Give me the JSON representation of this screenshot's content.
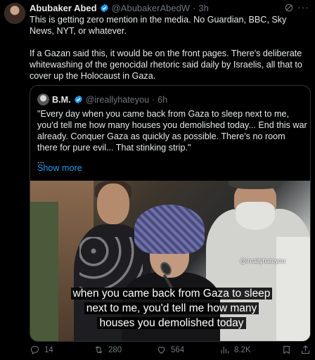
{
  "author": {
    "name": "Abubaker Abed",
    "handle": "@AbubakerAbedW",
    "separator": "·",
    "time": "3h"
  },
  "body": {
    "paragraph1": "This is getting zero mention in the media. No Guardian, BBC, Sky News, NYT, or whatever.",
    "paragraph2": "If a Gazan said this, it would be on the front pages. There's deliberate whitewashing of the genocidal rhetoric said daily by Israelis, all that to cover up the Holocaust in Gaza."
  },
  "quote": {
    "name": "B.M.",
    "handle": "@ireallyhateyou",
    "separator": "·",
    "time": "6h",
    "text": "\"Every day when you came back from Gaza to sleep next to me, you'd tell me how many houses you demolished today... End this war already. Conquer Gaza as quickly as possible. There's no room there for pure evil... That stinking strip.\"",
    "ellipsis": "...",
    "show_more": "Show more",
    "media": {
      "watermark": "@ireallyhateyou",
      "caption": "when you came back from Gaza to sleep next to me, you'd tell me how many houses you demolished today"
    }
  },
  "actions": {
    "replies": "14",
    "reposts": "280",
    "likes": "564",
    "views": "8.2K"
  },
  "colors": {
    "background": "#000000",
    "text": "#e7e9ea",
    "secondary": "#71767b",
    "accent": "#1d9bf0",
    "border": "#2f3336"
  }
}
